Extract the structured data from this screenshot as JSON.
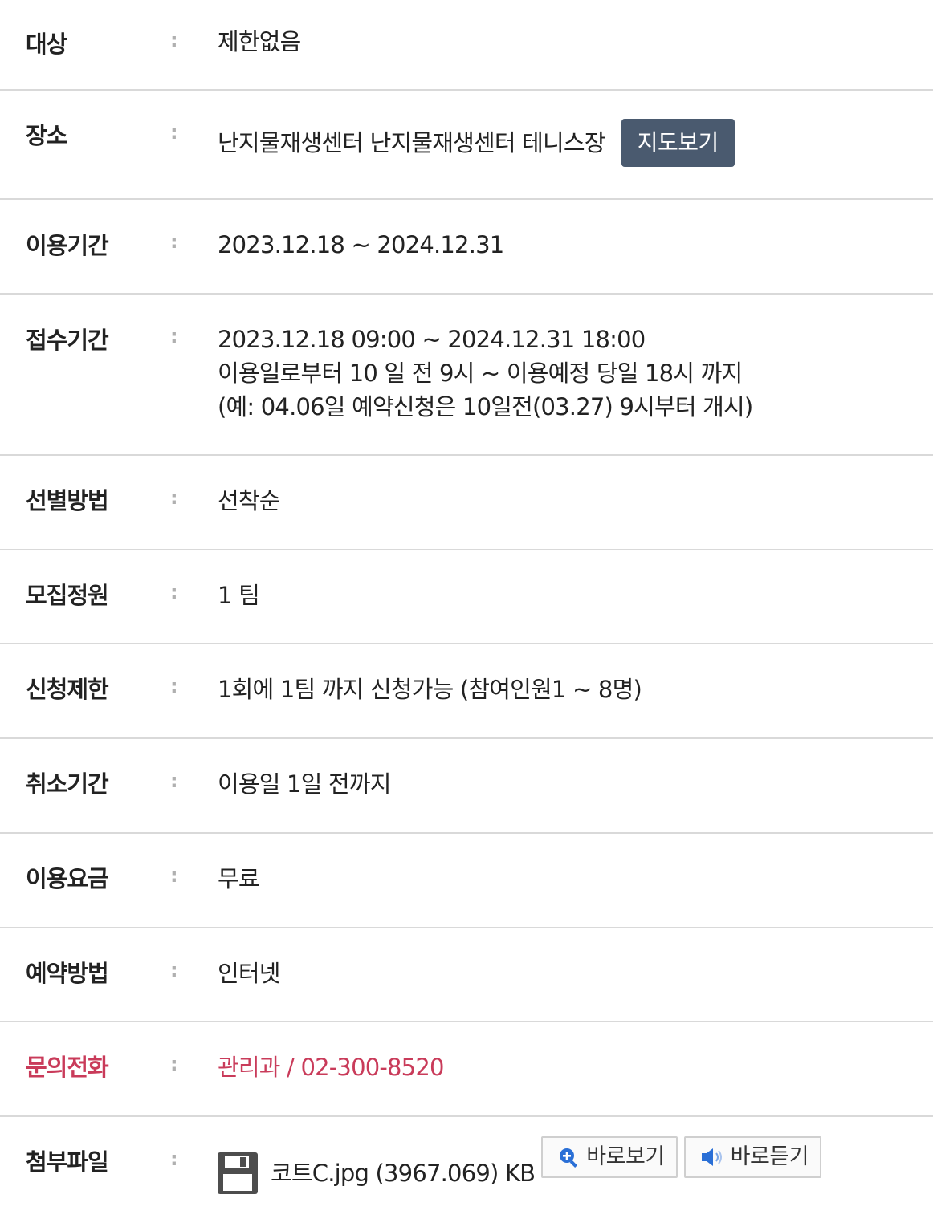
{
  "rows": [
    {
      "label": "대상",
      "value": "제한없음"
    },
    {
      "label": "장소",
      "value": "난지물재생센터 난지물재생센터 테니스장",
      "button": "지도보기"
    },
    {
      "label": "이용기간",
      "value": "2023.12.18 ~ 2024.12.31"
    },
    {
      "label": "접수기간",
      "lines": [
        "2023.12.18 09:00 ~ 2024.12.31 18:00",
        "이용일로부터 10 일 전 9시 ~ 이용예정 당일 18시 까지",
        "(예: 04.06일 예약신청은 10일전(03.27) 9시부터 개시)"
      ]
    },
    {
      "label": "선별방법",
      "value": "선착순"
    },
    {
      "label": "모집정원",
      "value": "1 팀"
    },
    {
      "label": "신청제한",
      "value": "1회에 1팀 까지 신청가능 (참여인원1 ~ 8명)"
    },
    {
      "label": "취소기간",
      "value": "이용일 1일 전까지"
    },
    {
      "label": "이용요금",
      "value": "무료"
    },
    {
      "label": "예약방법",
      "value": "인터넷"
    },
    {
      "label": "문의전화",
      "value": "관리과 / 02-300-8520"
    },
    {
      "label": "첨부파일",
      "file_name": "코트C.jpg (3967.069) KB",
      "preview_button": "바로보기",
      "listen_button": "바로듣기"
    }
  ],
  "colon": ":",
  "colors": {
    "accent_red": "#c93b5a",
    "map_button_bg": "#4a5a6f",
    "divider": "#d9d9d9"
  },
  "icons": [
    "floppy-disk-icon",
    "zoom-in-icon",
    "speaker-icon"
  ]
}
